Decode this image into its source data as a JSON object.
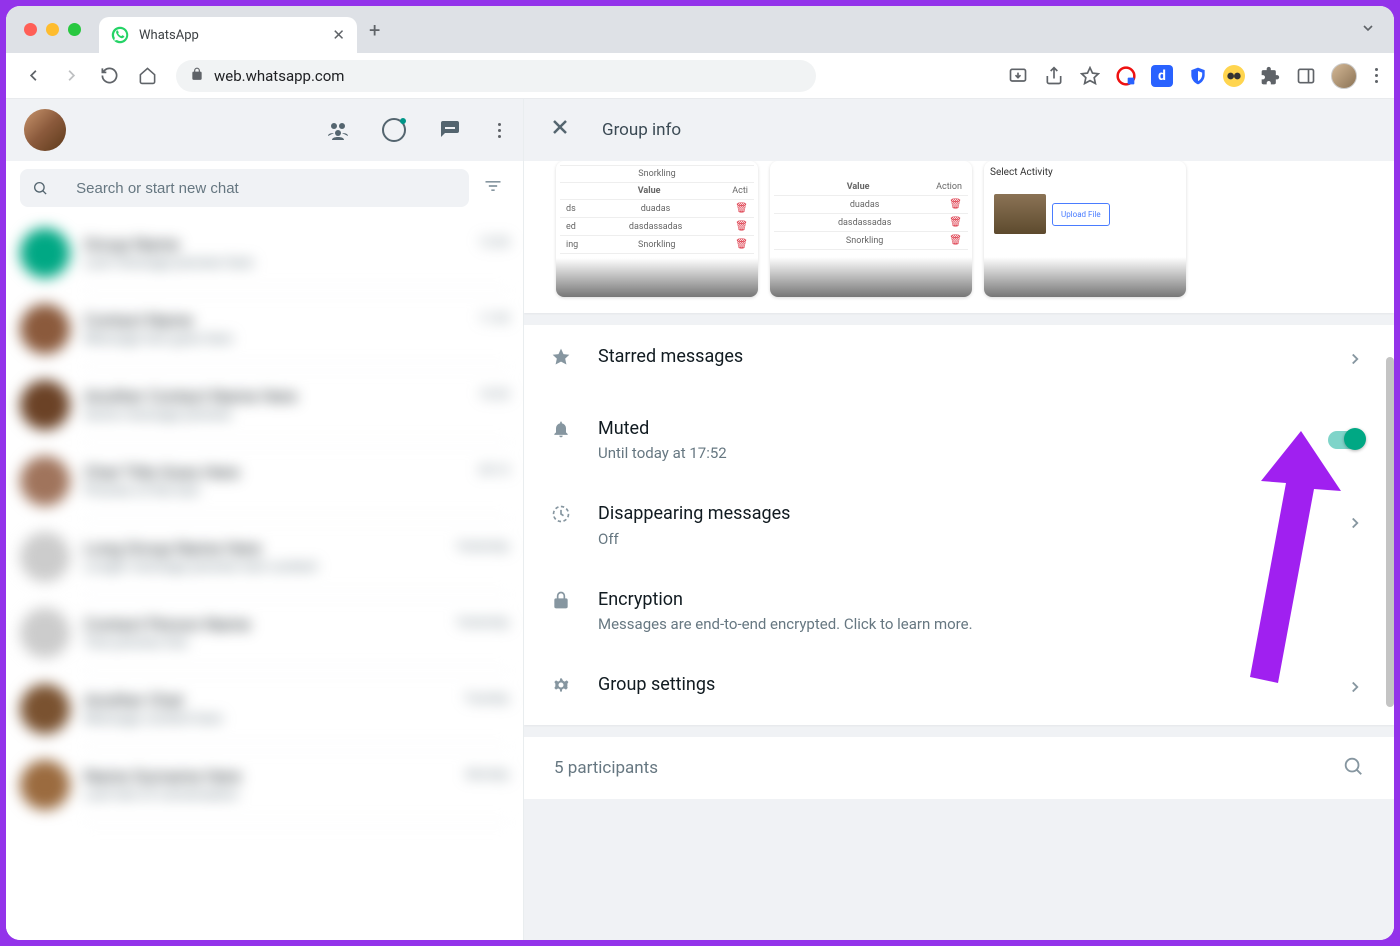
{
  "browser": {
    "tab_title": "WhatsApp",
    "url": "web.whatsapp.com"
  },
  "sidebar": {
    "search_placeholder": "Search or start new chat"
  },
  "panel": {
    "title": "Group info",
    "media": {
      "thumbs": [
        {
          "header_mid": "Value",
          "header_right": "Acti",
          "rows": [
            "duadas",
            "dasdassadas",
            "Snorkling"
          ],
          "top_row": "Snorkling"
        },
        {
          "header_mid": "Value",
          "header_right": "Action",
          "rows": [
            "duadas",
            "dasdassadas",
            "Snorkling"
          ]
        },
        {
          "title": "Select Activity",
          "button": "Upload File"
        }
      ]
    },
    "starred": {
      "title": "Starred messages"
    },
    "muted": {
      "title": "Muted",
      "sub": "Until today at 17:52"
    },
    "disappearing": {
      "title": "Disappearing messages",
      "sub": "Off"
    },
    "encryption": {
      "title": "Encryption",
      "sub": "Messages are end-to-end encrypted. Click to learn more."
    },
    "group_settings": {
      "title": "Group settings"
    },
    "participants": {
      "count": "5 participants"
    }
  }
}
